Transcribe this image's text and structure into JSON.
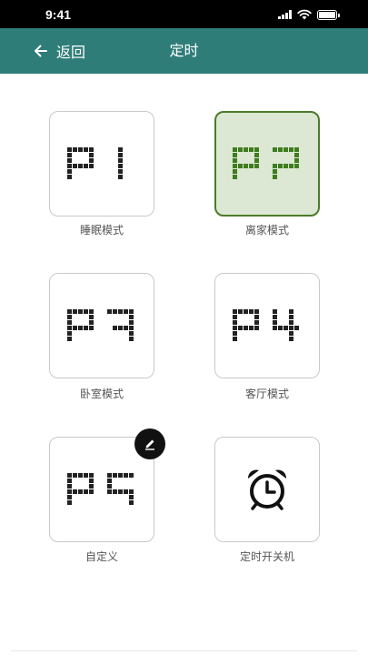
{
  "status_bar": {
    "time": "9:41"
  },
  "nav": {
    "back_label": "返回",
    "title": "定时"
  },
  "modes": [
    {
      "code": "P1",
      "label": "睡眠模式",
      "selected": false
    },
    {
      "code": "P2",
      "label": "离家模式",
      "selected": true
    },
    {
      "code": "P3",
      "label": "卧室模式",
      "selected": false
    },
    {
      "code": "P4",
      "label": "客厅模式",
      "selected": false
    },
    {
      "code": "P5",
      "label": "自定义",
      "selected": false,
      "editable": true
    }
  ],
  "timer": {
    "label": "定时开关机",
    "icon": "alarm-clock-icon"
  },
  "colors": {
    "header": "#2f7d79",
    "selected_border": "#4b7b2b",
    "selected_bg": "#dce8d3",
    "selected_digits": "#3f7d1f",
    "digits": "#222222"
  }
}
